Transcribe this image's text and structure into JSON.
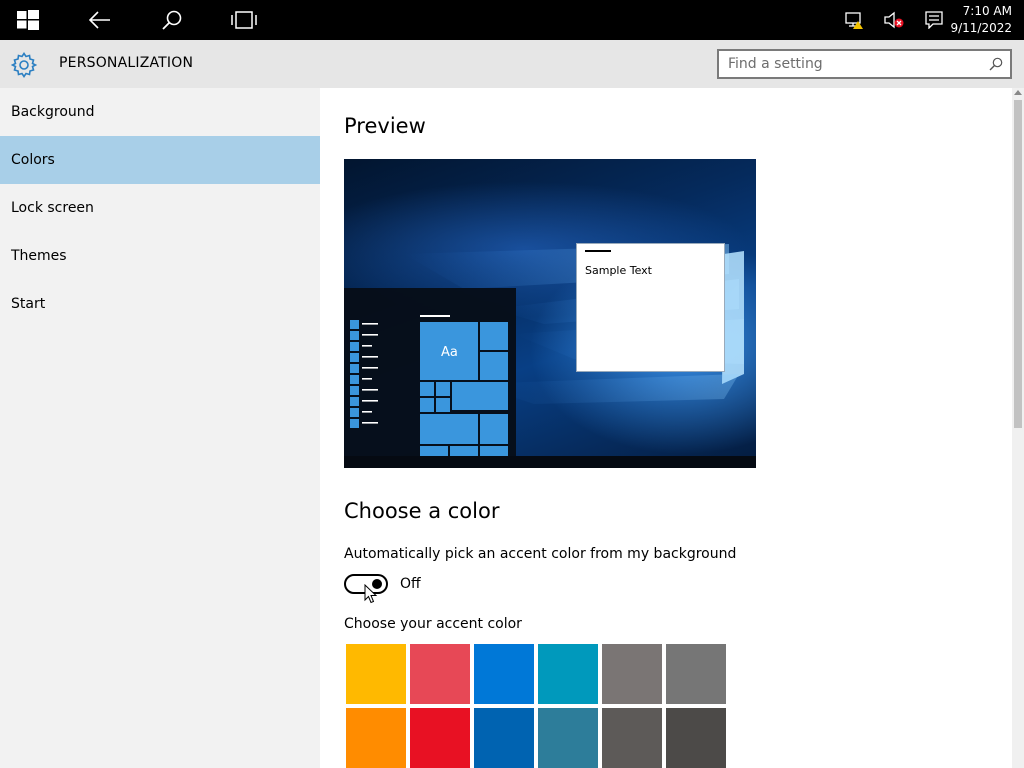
{
  "taskbar": {
    "icons": [
      "windows-logo-icon",
      "back-arrow-icon",
      "search-icon",
      "task-view-icon",
      "network-warning-icon",
      "volume-muted-icon",
      "action-center-icon"
    ],
    "time": "7:10 AM",
    "date": "9/11/2022"
  },
  "header": {
    "title": "PERSONALIZATION",
    "search_placeholder": "Find a setting"
  },
  "sidebar": {
    "items": [
      {
        "label": "Background",
        "selected": false
      },
      {
        "label": "Colors",
        "selected": true
      },
      {
        "label": "Lock screen",
        "selected": false
      },
      {
        "label": "Themes",
        "selected": false
      },
      {
        "label": "Start",
        "selected": false
      }
    ]
  },
  "main": {
    "preview_heading": "Preview",
    "preview": {
      "sample_text": "Sample Text",
      "tile_text": "Aa"
    },
    "color_heading": "Choose a color",
    "auto_pick_label": "Automatically pick an accent color from my background",
    "auto_pick_state": "Off",
    "accent_label": "Choose your accent color",
    "accent_colors": [
      [
        "#FFB900",
        "#E74856",
        "#0078D7",
        "#0099BC",
        "#7A7574",
        "#767676"
      ],
      [
        "#FF8C00",
        "#E81123",
        "#0063B1",
        "#2D7D9A",
        "#5D5A58",
        "#4C4A48"
      ]
    ]
  },
  "colors": {
    "accent": "#3A96DD",
    "sidebar_selected": "#A8CFE8"
  }
}
